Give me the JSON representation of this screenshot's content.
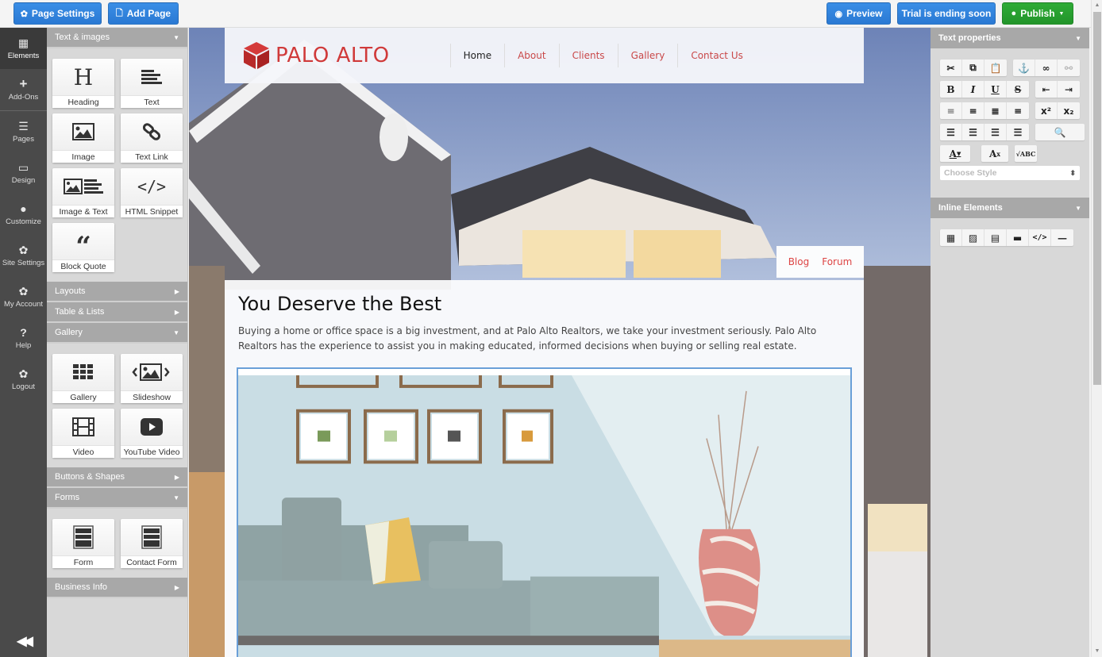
{
  "toolbar": {
    "page_settings": "Page Settings",
    "add_page": "Add Page",
    "preview": "Preview",
    "trial": "Trial is ending soon",
    "publish": "Publish"
  },
  "leftnav": {
    "items": [
      {
        "label": "Elements",
        "icon": "grid-icon"
      },
      {
        "label": "Add-Ons",
        "icon": "plus-icon"
      },
      {
        "label": "Pages",
        "icon": "menu-icon"
      },
      {
        "label": "Design",
        "icon": "monitor-icon"
      },
      {
        "label": "Customize",
        "icon": "drop-icon"
      },
      {
        "label": "Site Settings",
        "icon": "gear-icon"
      },
      {
        "label": "My Account",
        "icon": "gear-icon"
      },
      {
        "label": "Help",
        "icon": "question-icon"
      },
      {
        "label": "Logout",
        "icon": "gear-icon"
      }
    ]
  },
  "elements_panel": {
    "text_images": {
      "title": "Text & images",
      "tiles": [
        "Heading",
        "Text",
        "Image",
        "Text Link",
        "Image & Text",
        "HTML Snippet",
        "Block Quote"
      ]
    },
    "layouts": "Layouts",
    "table_lists": "Table & Lists",
    "gallery": {
      "title": "Gallery",
      "tiles": [
        "Gallery",
        "Slideshow",
        "Video",
        "YouTube Video"
      ]
    },
    "buttons_shapes": "Buttons & Shapes",
    "forms": {
      "title": "Forms",
      "tiles": [
        "Form",
        "Contact Form"
      ]
    },
    "business_info": "Business Info"
  },
  "site": {
    "logo_text": "PALO ALTO",
    "brand_color": "#d03a3a",
    "nav": [
      "Home",
      "About",
      "Clients",
      "Gallery",
      "Contact Us"
    ],
    "subnav": [
      "Blog",
      "Forum"
    ],
    "heading": "You Deserve the Best",
    "body": "Buying a home or office space is a big investment, and at Palo Alto Realtors, we take your investment seriously. Palo Alto Realtors has the experience to assist you in making educated, informed decisions when buying or selling real estate."
  },
  "right_panel": {
    "text_properties": "Text properties",
    "choose_style": "Choose Style",
    "inline_elements": "Inline Elements"
  }
}
